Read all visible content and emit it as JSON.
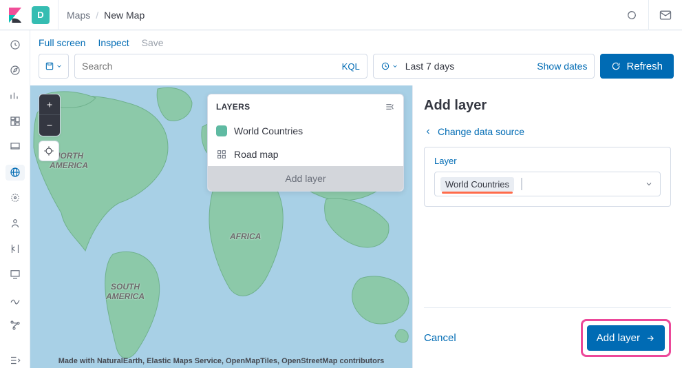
{
  "header": {
    "avatar_initial": "D",
    "breadcrumb": {
      "root": "Maps",
      "current": "New Map"
    }
  },
  "toolbar": {
    "full_screen": "Full screen",
    "inspect": "Inspect",
    "save": "Save",
    "search_placeholder": "Search",
    "kql": "KQL",
    "time_range": "Last 7 days",
    "show_dates": "Show dates",
    "refresh": "Refresh"
  },
  "layers_panel": {
    "title": "LAYERS",
    "items": [
      {
        "label": "World Countries"
      },
      {
        "label": "Road map"
      }
    ],
    "add_button": "Add layer"
  },
  "map": {
    "labels": {
      "north_america": "NORTH\nAMERICA",
      "south_america": "SOUTH\nAMERICA",
      "africa": "AFRICA"
    },
    "attribution": "Made with NaturalEarth, Elastic Maps Service, OpenMapTiles, OpenStreetMap contributors"
  },
  "right_panel": {
    "title": "Add layer",
    "change_source": "Change data source",
    "layer_label": "Layer",
    "selected_layer": "World Countries",
    "cancel": "Cancel",
    "add_layer": "Add layer"
  },
  "colors": {
    "accent": "#006bb4"
  }
}
